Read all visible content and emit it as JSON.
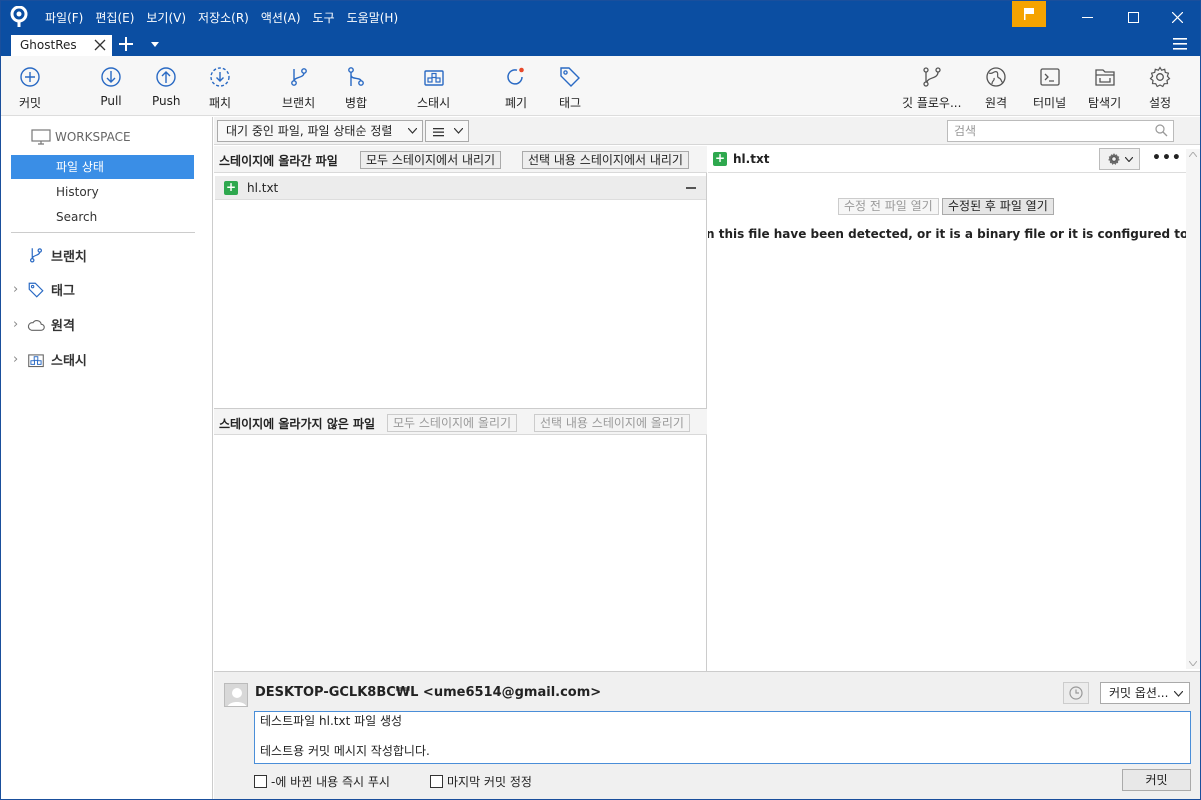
{
  "menu": [
    "파일(F)",
    "편집(E)",
    "보기(V)",
    "저장소(R)",
    "액션(A)",
    "도구",
    "도움말(H)"
  ],
  "tab": {
    "title": "GhostRes"
  },
  "toolbar": {
    "commit": "커밋",
    "pull": "Pull",
    "push": "Push",
    "fetch": "패치",
    "branch": "브랜치",
    "merge": "병합",
    "stash": "스태시",
    "discard": "폐기",
    "tag": "태그",
    "gitflow": "깃 플로우...",
    "remote": "원격",
    "terminal": "터미널",
    "explorer": "탐색기",
    "settings": "설정"
  },
  "sidebar": {
    "workspace": "WORKSPACE",
    "items": [
      "파일 상태",
      "History",
      "Search"
    ],
    "groups": {
      "branches": "브랜치",
      "tags": "태그",
      "remotes": "원격",
      "stashes": "스태시"
    }
  },
  "filter": {
    "sort": "대기 중인 파일, 파일 상태순 정렬",
    "search_placeholder": "검색"
  },
  "staged": {
    "title": "스테이지에 올라간 파일",
    "unstage_all": "모두 스테이지에서 내리기",
    "unstage_selected": "선택 내용 스테이지에서 내리기",
    "files": [
      {
        "name": "hl.txt"
      }
    ]
  },
  "unstaged": {
    "title": "스테이지에 올라가지 않은 파일",
    "stage_all": "모두 스테이지에 올리기",
    "stage_selected": "선택 내용 스테이지에 올리기"
  },
  "diff": {
    "filename": "hl.txt",
    "open_before": "수정 전 파일 열기",
    "open_after": "수정된 후 파일 열기",
    "message": "n this file have been detected, or it is a binary file or it is configured to be ignored by the"
  },
  "commit": {
    "author": "DESKTOP-GCLK8BC₩L <ume6514@gmail.com>",
    "options": "커밋 옵션...",
    "message_line1": "테스트파일 hl.txt 파일 생성",
    "message_line2": "테스트용 커밋 메시지 작성합니다.",
    "push_immediately": "-에 바뀐 내용 즉시 푸시",
    "amend": "마지막 커밋 정정",
    "button": "커밋"
  }
}
